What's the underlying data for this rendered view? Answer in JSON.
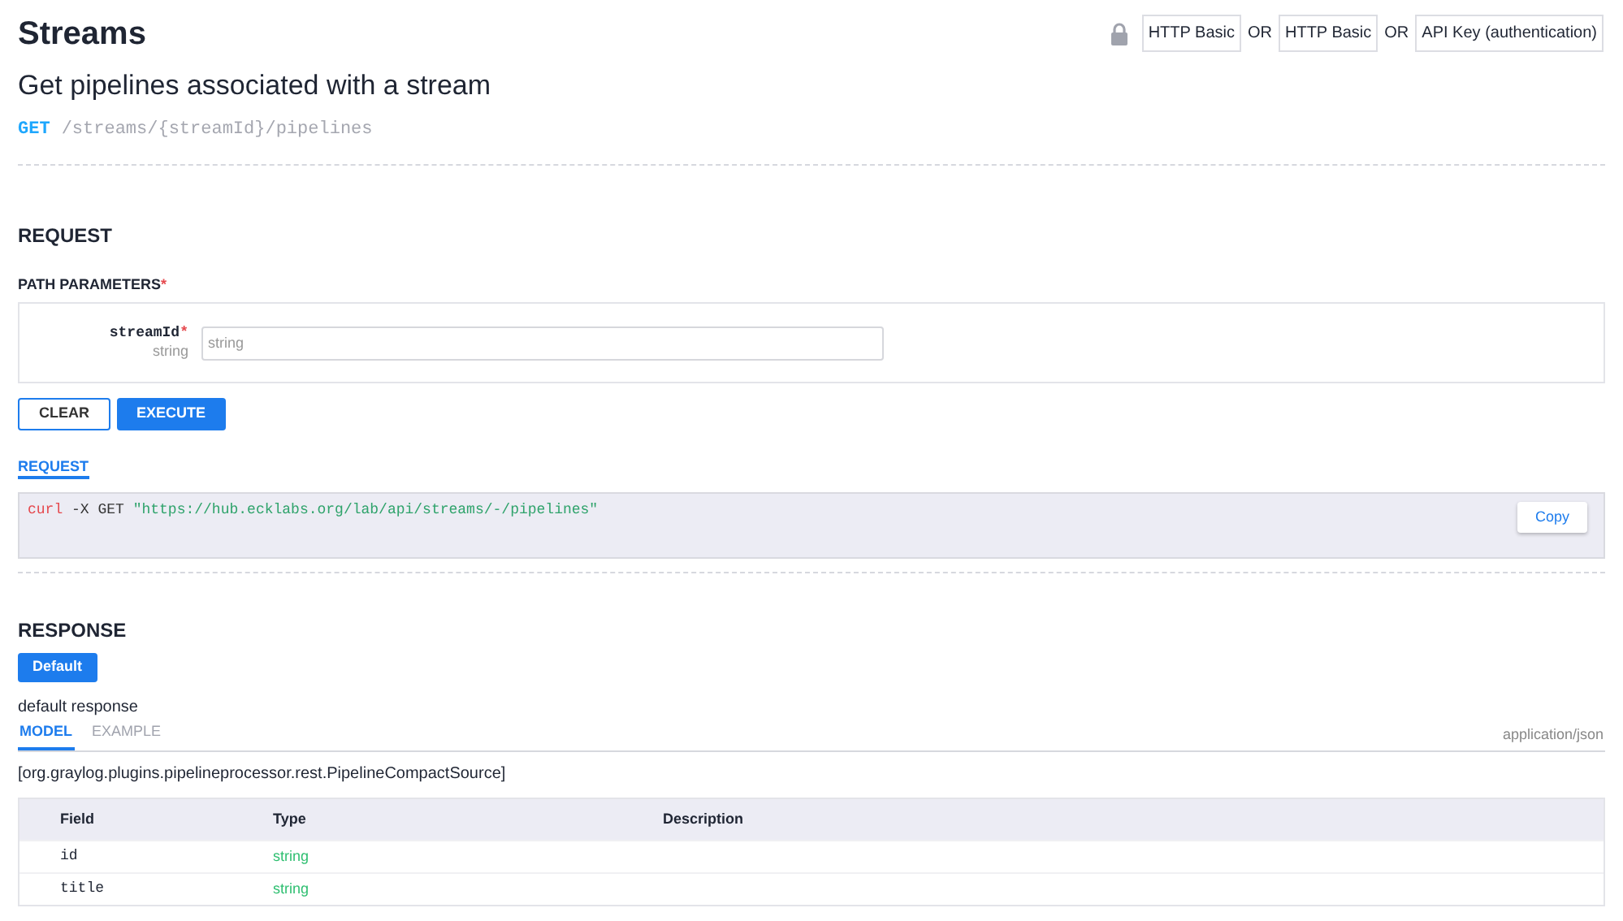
{
  "header": {
    "title": "Streams",
    "summary": "Get pipelines associated with a stream",
    "method": "GET",
    "path": "/streams/{streamId}/pipelines"
  },
  "auth": {
    "items": [
      {
        "kind": "scheme",
        "text": "HTTP Basic"
      },
      {
        "kind": "separator",
        "text": "OR"
      },
      {
        "kind": "scheme",
        "text": "HTTP Basic"
      },
      {
        "kind": "separator",
        "text": "OR"
      },
      {
        "kind": "scheme",
        "text": "API Key (authentication)"
      }
    ]
  },
  "request": {
    "heading": "REQUEST",
    "params_heading": "PATH PARAMETERS",
    "required_mark": "*",
    "params": [
      {
        "name": "streamId",
        "required_mark": "*",
        "type": "string",
        "placeholder": "string"
      }
    ],
    "buttons": [
      {
        "label": "CLEAR",
        "kind": "secondary"
      },
      {
        "label": "EXECUTE",
        "kind": "primary"
      }
    ],
    "snippet_tab": "REQUEST",
    "snippet": [
      {
        "kind": "command",
        "text": "curl"
      },
      {
        "kind": "plain",
        "text": " -X GET "
      },
      {
        "kind": "string",
        "text": "\"https://hub.ecklabs.org/lab/api/streams/-/pipelines\""
      }
    ],
    "copy_button": "Copy"
  },
  "response": {
    "heading": "RESPONSE",
    "status_button": "Default",
    "description": "default response",
    "tabs": [
      {
        "label": "MODEL",
        "selected": true
      },
      {
        "label": "EXAMPLE",
        "selected": false
      }
    ],
    "content_type": "application/json",
    "model_name": "[org.graylog.plugins.pipelineprocessor.rest.PipelineCompactSource]",
    "table": {
      "columns": [
        "Field",
        "Type",
        "Description"
      ],
      "rows": [
        {
          "field": "id",
          "type": "string"
        },
        {
          "field": "title",
          "type": "string"
        }
      ]
    }
  }
}
